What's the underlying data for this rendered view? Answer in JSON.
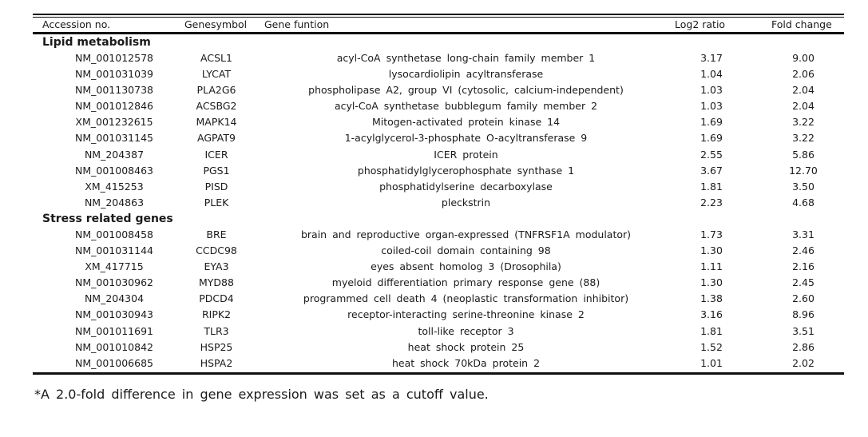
{
  "table": {
    "headers": {
      "accession": "Accession no.",
      "genesymbol": "Genesymbol",
      "function": "Gene funtion",
      "log2": "Log2 ratio",
      "fold": "Fold change"
    },
    "sections": [
      {
        "title": "Lipid metabolism",
        "rows": [
          {
            "accession": "NM_001012578",
            "symbol": "ACSL1",
            "function": "acyl-CoA  synthetase long-chain family member 1",
            "log2": "3.17",
            "fold": "9.00"
          },
          {
            "accession": "NM_001031039",
            "symbol": "LYCAT",
            "function": "lysocardiolipin  acyltransferase",
            "log2": "1.04",
            "fold": "2.06"
          },
          {
            "accession": "NM_001130738",
            "symbol": "PLA2G6",
            "function": "phospholipase  A2, group VI (cytosolic, calcium-independent)",
            "log2": "1.03",
            "fold": "2.04"
          },
          {
            "accession": "NM_001012846",
            "symbol": "ACSBG2",
            "function": "acyl-CoA  synthetase bubblegum family member 2",
            "log2": "1.03",
            "fold": "2.04"
          },
          {
            "accession": "XM_001232615",
            "symbol": "MAPK14",
            "function": "Mitogen-activated  protein kinase 14",
            "log2": "1.69",
            "fold": "3.22"
          },
          {
            "accession": "NM_001031145",
            "symbol": "AGPAT9",
            "function": "1-acylglycerol-3-phosphate  O-acyltransferase 9",
            "log2": "1.69",
            "fold": "3.22"
          },
          {
            "accession": "NM_204387",
            "symbol": "ICER",
            "function": "ICER  protein",
            "log2": "2.55",
            "fold": "5.86"
          },
          {
            "accession": "NM_001008463",
            "symbol": "PGS1",
            "function": "phosphatidylglycerophosphate  synthase 1",
            "log2": "3.67",
            "fold": "12.70"
          },
          {
            "accession": "XM_415253",
            "symbol": "PISD",
            "function": "phosphatidylserine  decarboxylase",
            "log2": "1.81",
            "fold": "3.50"
          },
          {
            "accession": "NM_204863",
            "symbol": "PLEK",
            "function": "pleckstrin",
            "log2": "2.23",
            "fold": "4.68"
          }
        ]
      },
      {
        "title": "Stress related genes",
        "rows": [
          {
            "accession": "NM_001008458",
            "symbol": "BRE",
            "function": "brain and  reproductive organ-expressed (TNFRSF1A modulator)",
            "log2": "1.73",
            "fold": "3.31"
          },
          {
            "accession": "NM_001031144",
            "symbol": "CCDC98",
            "function": "coiled-coil  domain containing 98",
            "log2": "1.30",
            "fold": "2.46"
          },
          {
            "accession": "XM_417715",
            "symbol": "EYA3",
            "function": "eyes absent  homolog 3 (Drosophila)",
            "log2": "1.11",
            "fold": "2.16"
          },
          {
            "accession": "NM_001030962",
            "symbol": "MYD88",
            "function": "myeloid  differentiation primary response gene (88)",
            "log2": "1.30",
            "fold": "2.45"
          },
          {
            "accession": "NM_204304",
            "symbol": "PDCD4",
            "function": "programmed  cell death 4 (neoplastic transformation inhibitor)",
            "log2": "1.38",
            "fold": "2.60"
          },
          {
            "accession": "NM_001030943",
            "symbol": "RIPK2",
            "function": "receptor-interacting  serine-threonine kinase 2",
            "log2": "3.16",
            "fold": "8.96"
          },
          {
            "accession": "NM_001011691",
            "symbol": "TLR3",
            "function": "toll-like  receptor 3",
            "log2": "1.81",
            "fold": "3.51"
          },
          {
            "accession": "NM_001010842",
            "symbol": "HSP25",
            "function": "heat shock  protein 25",
            "log2": "1.52",
            "fold": "2.86"
          },
          {
            "accession": "NM_001006685",
            "symbol": "HSPA2",
            "function": "heat shock  70kDa protein 2",
            "log2": "1.01",
            "fold": "2.02"
          }
        ]
      }
    ]
  },
  "footnote": "*A 2.0-fold difference in gene expression was set as a cutoff value."
}
